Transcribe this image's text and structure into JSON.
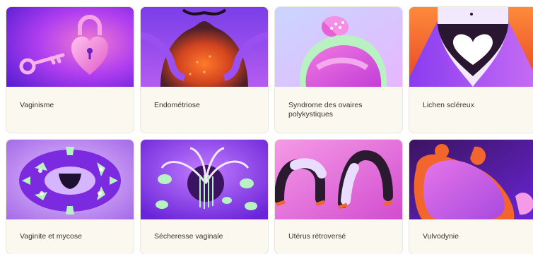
{
  "cards": [
    {
      "label": "Vaginisme",
      "illustration": "padlock-heart-key"
    },
    {
      "label": "Endométriose",
      "illustration": "abdomen-hands-glow"
    },
    {
      "label": "Syndrome des ovaires polykystiques",
      "illustration": "woman-hugging-ovary"
    },
    {
      "label": "Lichen scléreux",
      "illustration": "underwear-heart"
    },
    {
      "label": "Vaginite et mycose",
      "illustration": "mushroom-ring"
    },
    {
      "label": "Sécheresse vaginale",
      "illustration": "drooping-plant-vase"
    },
    {
      "label": "Utérus rétroversé",
      "illustration": "bending-legs"
    },
    {
      "label": "Vulvodynie",
      "illustration": "person-curled"
    }
  ],
  "colors": {
    "card_bg": "#fbf8ef",
    "purple": "#7b2ae0",
    "pink": "#e85fd6",
    "orange": "#f2652c",
    "mint": "#b9f2c2"
  }
}
